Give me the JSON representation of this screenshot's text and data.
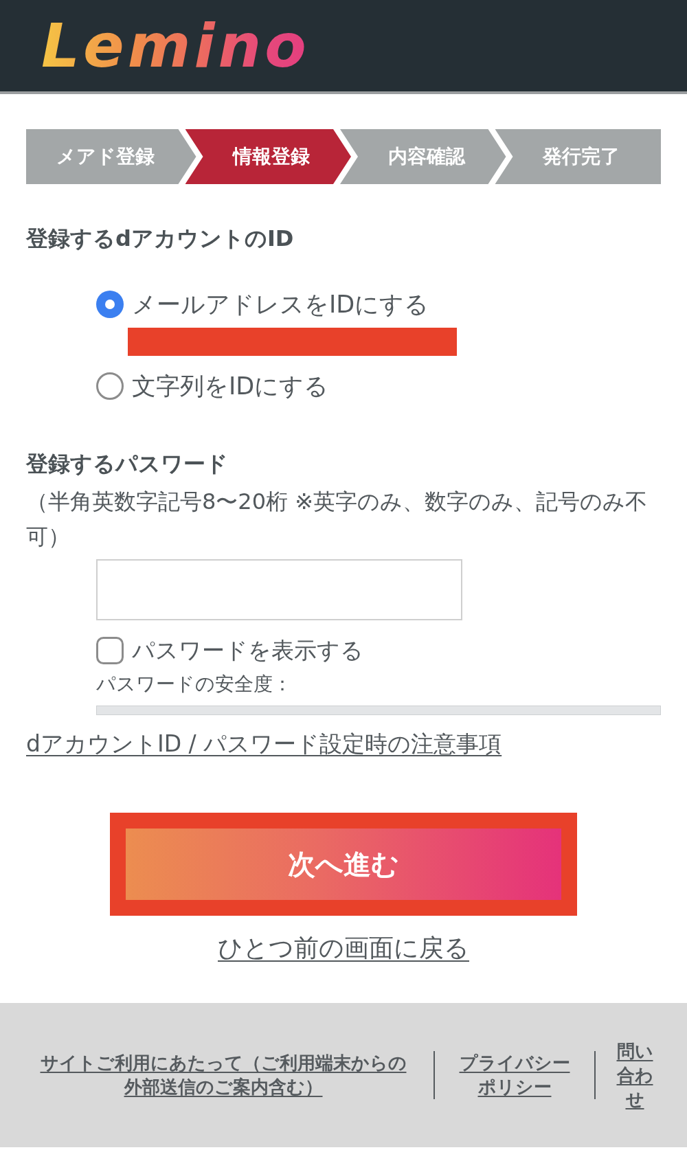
{
  "header": {
    "logo": "Lemino"
  },
  "steps": [
    {
      "label": "メアド登録",
      "selected": false
    },
    {
      "label": "情報登録",
      "selected": true
    },
    {
      "label": "内容確認",
      "selected": false
    },
    {
      "label": "発行完了",
      "selected": false
    }
  ],
  "id_section": {
    "heading": "登録するdアカウントのID",
    "options": [
      {
        "label": "メールアドレスをIDにする",
        "selected": true,
        "redacted": true
      },
      {
        "label": "文字列をIDにする",
        "selected": false,
        "redacted": false
      }
    ]
  },
  "password_section": {
    "heading": "登録するパスワード",
    "note": "（半角英数字記号8〜20桁 ※英字のみ、数字のみ、記号のみ不可）",
    "show_password": {
      "label": "パスワードを表示する",
      "checked": false
    },
    "strength": {
      "label": "パスワードの安全度："
    }
  },
  "notice_link": "dアカウントID / パスワード設定時の注意事項",
  "next_button": {
    "label": "次へ進む",
    "highlighted": true
  },
  "back_link": "ひとつ前の画面に戻る",
  "footer": {
    "links": [
      "サイトご利用にあたって（ご利用端末からの外部送信のご案内含む）",
      "プライバシーポリシー",
      "問い合わせ"
    ]
  }
}
